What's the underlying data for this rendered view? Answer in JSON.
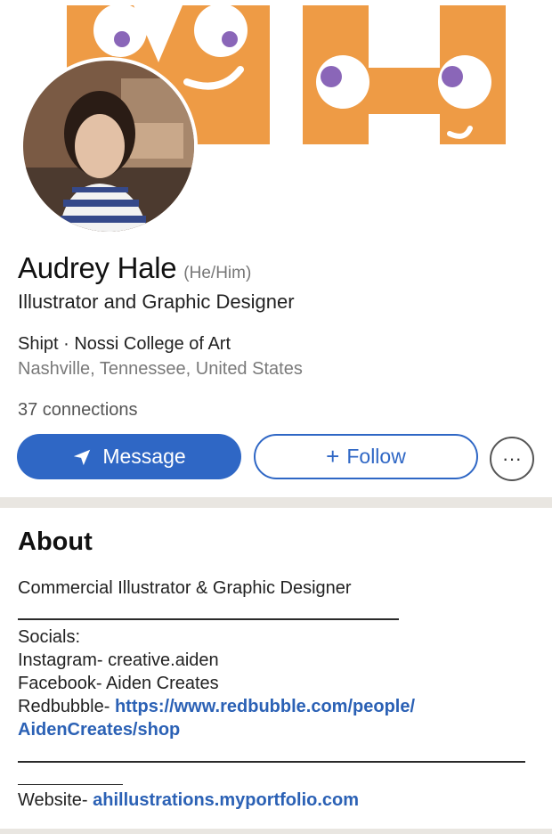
{
  "profile": {
    "name": "Audrey Hale",
    "pronouns": "(He/Him)",
    "headline": "Illustrator and Graphic Designer",
    "company_school": "Shipt · Nossi College of Art",
    "location": "Nashville, Tennessee, United States",
    "connections": "37 connections"
  },
  "actions": {
    "message_label": "Message",
    "follow_label": "Follow",
    "follow_prefix": "+",
    "more_label": "···"
  },
  "about": {
    "title": "About",
    "line1": "Commercial Illustrator & Graphic Designer",
    "socials_label": "Socials:",
    "instagram": "Instagram- creative.aiden",
    "facebook": "Facebook- Aiden Creates",
    "redbubble_label": "Redbubble- ",
    "redbubble_link_1": "https://www.redbubble.com/people/",
    "redbubble_link_2": "AidenCreates/shop",
    "website_label": "Website- ",
    "website_link": "ahillustrations.myportfolio.com"
  },
  "colors": {
    "accent_blue": "#2f67c5",
    "banner_orange": "#ee9b45",
    "eye_purple": "#8a66b8",
    "section_gray": "#e9e6e1"
  },
  "icons": {
    "message": "paper-plane-icon",
    "follow": "plus-icon",
    "more": "ellipsis-icon"
  }
}
